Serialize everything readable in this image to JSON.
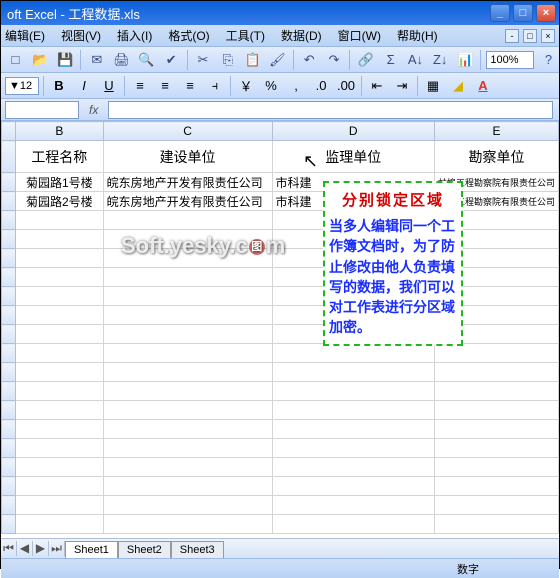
{
  "app": {
    "title": "oft Excel - 工程数据.xls"
  },
  "menu": {
    "items": [
      "编辑(E)",
      "视图(V)",
      "插入(I)",
      "格式(O)",
      "工具(T)",
      "数据(D)",
      "窗口(W)",
      "帮助(H)"
    ]
  },
  "toolbar": {
    "zoom": "100%",
    "icons": [
      "new",
      "open",
      "save",
      "mail",
      "print",
      "preview",
      "spell",
      "cut",
      "copy",
      "paste",
      "fmtpaint",
      "undo",
      "redo",
      "link",
      "sum",
      "sortasc",
      "sortdesc",
      "chart"
    ]
  },
  "formatbar": {
    "fontSize": "12",
    "bold": "B",
    "italic": "I",
    "underline": "U"
  },
  "formula": {
    "nameBox": "",
    "fx": "fx"
  },
  "columns": {
    "B": "B",
    "C": "C",
    "D": "D",
    "E": "E"
  },
  "headers": {
    "B": "工程名称",
    "C": "建设单位",
    "D": "监理单位",
    "E": "勘察单位"
  },
  "rows": [
    {
      "B": "菊园路1号楼",
      "C": "皖东房地产开发有限责任公司",
      "D": "市科建",
      "E": "蚌埠工程勘察院有限责任公司"
    },
    {
      "B": "菊园路2号楼",
      "C": "皖东房地产开发有限责任公司",
      "D": "市科建",
      "E": "蚌埠工程勘察院有限责任公司"
    }
  ],
  "callout": {
    "title": "分别锁定区域",
    "body": "当多人编辑同一个工作簿文档时，为了防止修改由他人负责填写的数据，我们可以对工作表进行分区域加密。"
  },
  "watermark": {
    "text": "Soft.yesky.c",
    "suffix": "m"
  },
  "sheets": {
    "tabs": [
      "Sheet1",
      "Sheet2",
      "Sheet3"
    ],
    "active": 0
  },
  "status": {
    "mode": "数字"
  },
  "colWidths": {
    "row": 16,
    "B": 90,
    "C": 170,
    "D": 180,
    "E": 100
  }
}
